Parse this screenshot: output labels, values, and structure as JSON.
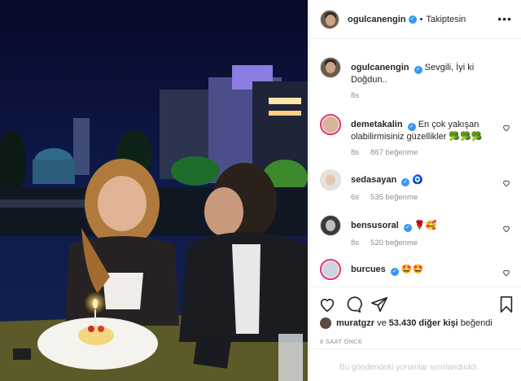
{
  "post": {
    "author": "ogulcanengin",
    "follow_status": "Takiptesin",
    "separator": "•",
    "more_icon": "ellipsis-icon"
  },
  "caption": {
    "username": "ogulcanengin",
    "text": "Sevgili, İyi ki Doğdun..",
    "age": "8s"
  },
  "comments": [
    {
      "username": "demetakalin",
      "text": "En çok yakışan olabilirmisiniz güzellikler 🥦🥦🥦",
      "age": "8s",
      "likes": "867 beğenme"
    },
    {
      "username": "sedasayan",
      "text": "🧿",
      "age": "6s",
      "likes": "535 beğenme"
    },
    {
      "username": "bensusoral",
      "text": "🌹🥰",
      "age": "8s",
      "likes": "520 beğenme"
    },
    {
      "username": "burcues",
      "text": "🤩🤩",
      "age": "",
      "likes": ""
    }
  ],
  "likes_line": {
    "user": "muratgzr",
    "joiner": "ve",
    "others": "53.430 diğer kişi",
    "suffix": "beğendi"
  },
  "posted_ago": "8 SAAT ÖNCE",
  "comments_limited": "Bu gönderideki yorumlar sınırlandırıldı.",
  "colors": {
    "verified": "#3897f0",
    "muted": "#8e8e8e",
    "text": "#262626"
  }
}
